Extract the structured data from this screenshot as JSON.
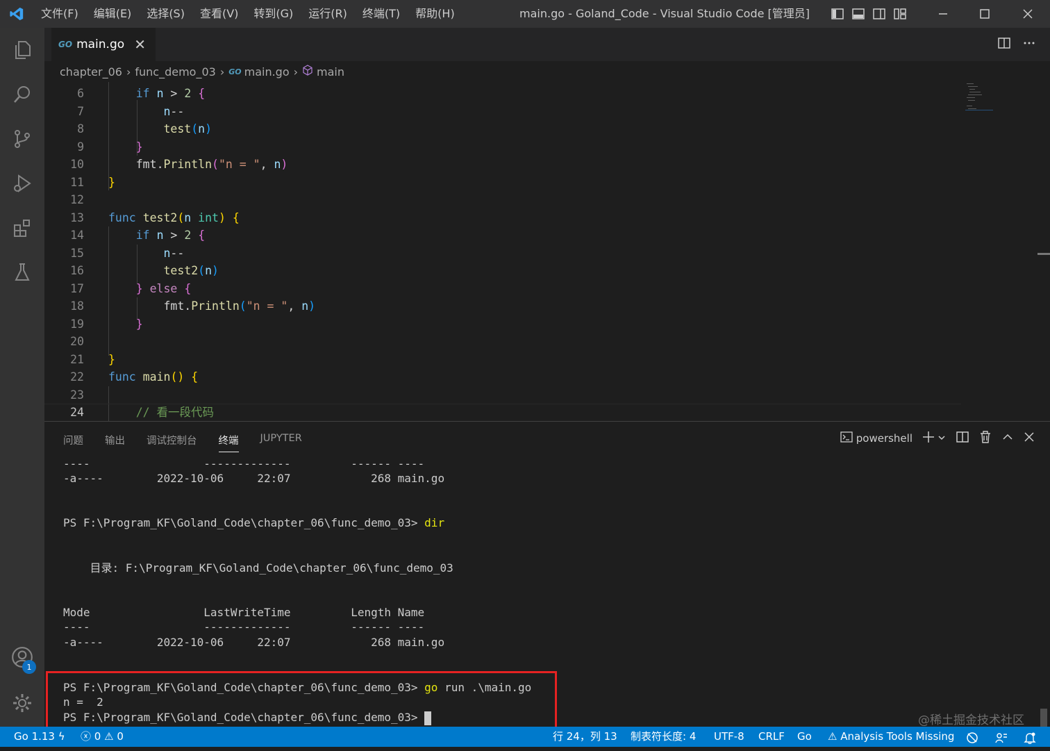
{
  "window": {
    "title": "main.go - Goland_Code - Visual Studio Code [管理员]",
    "menu": [
      "文件(F)",
      "编辑(E)",
      "选择(S)",
      "查看(V)",
      "转到(G)",
      "运行(R)",
      "终端(T)",
      "帮助(H)"
    ]
  },
  "tab": {
    "icon_text": "GO",
    "filename": "main.go",
    "close": "✕"
  },
  "breadcrumb": {
    "items": [
      "chapter_06",
      "func_demo_03",
      "main.go",
      "main"
    ],
    "go_icon_text": "GO"
  },
  "activity": {
    "account_badge": "1"
  },
  "code": {
    "lines": [
      {
        "n": "6"
      },
      {
        "n": "7"
      },
      {
        "n": "8"
      },
      {
        "n": "9"
      },
      {
        "n": "10"
      },
      {
        "n": "11"
      },
      {
        "n": "12"
      },
      {
        "n": "13"
      },
      {
        "n": "14"
      },
      {
        "n": "15"
      },
      {
        "n": "16"
      },
      {
        "n": "17"
      },
      {
        "n": "18"
      },
      {
        "n": "19"
      },
      {
        "n": "20"
      },
      {
        "n": "21"
      },
      {
        "n": "22"
      },
      {
        "n": "23"
      },
      {
        "n": "24"
      }
    ]
  },
  "panel": {
    "tabs": [
      "问题",
      "输出",
      "调试控制台",
      "终端",
      "JUPYTER"
    ],
    "active_tab": "终端",
    "shell": "powershell"
  },
  "terminal": {
    "lines": [
      "----                 -------------         ------ ----",
      "-a----        2022-10-06     22:07            268 main.go",
      "",
      "",
      "PS F:\\Program_KF\\Goland_Code\\chapter_06\\func_demo_03> ",
      "",
      "",
      "    目录: F:\\Program_KF\\Goland_Code\\chapter_06\\func_demo_03",
      "",
      "",
      "Mode                 LastWriteTime         Length Name",
      "----                 -------------         ------ ----",
      "-a----        2022-10-06     22:07            268 main.go",
      "",
      "",
      "PS F:\\Program_KF\\Goland_Code\\chapter_06\\func_demo_03> ",
      "n =  2",
      "PS F:\\Program_KF\\Goland_Code\\chapter_06\\func_demo_03> "
    ],
    "cmd_dir": "dir",
    "cmd_go": "go",
    "cmd_go_args": " run .\\main.go"
  },
  "status": {
    "go_version": "Go 1.13",
    "errors": "0",
    "warnings": "0",
    "position": "行 24，列 13",
    "tab_size": "制表符长度: 4",
    "encoding": "UTF-8",
    "eol": "CRLF",
    "language": "Go",
    "analysis": "Analysis Tools Missing"
  },
  "watermark": "@稀土掘金技术社区",
  "colors": {
    "accent": "#007acc",
    "highlight_box": "#e52222"
  }
}
